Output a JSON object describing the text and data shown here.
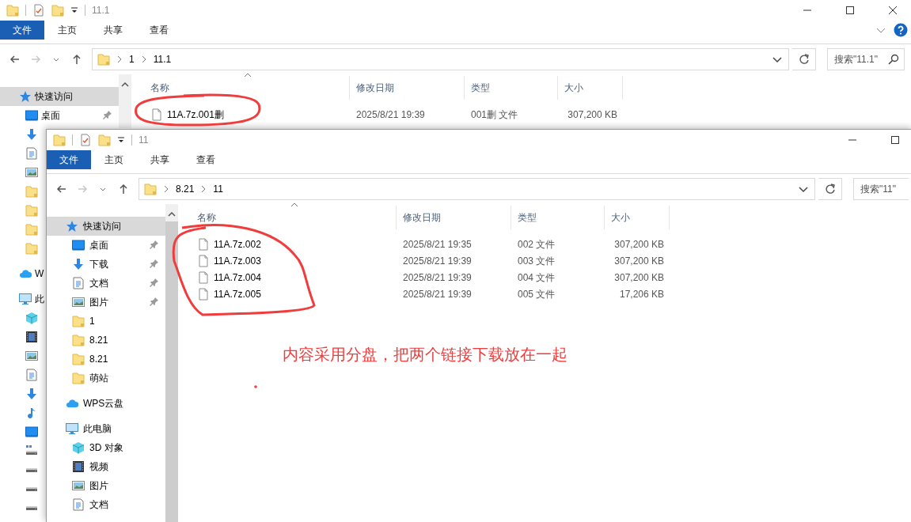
{
  "windows": [
    {
      "title": "11.1",
      "close_button": true,
      "ribbon_extras": true,
      "ribbon_tabs": [
        {
          "label": "文件",
          "selected": true
        },
        {
          "label": "主页",
          "selected": false
        },
        {
          "label": "共享",
          "selected": false
        },
        {
          "label": "查看",
          "selected": false
        }
      ],
      "breadcrumb": [
        "1",
        "11.1"
      ],
      "search": {
        "placeholder": "搜索\"11.1\"",
        "show_icon": true
      },
      "sidebar": [
        {
          "label": "快速访问",
          "kind": "star",
          "selected": true,
          "children": [
            {
              "label": "桌面",
              "kind": "desktop",
              "selected": false,
              "pinned": true
            },
            {
              "kind": "download",
              "selected": false
            },
            {
              "kind": "doc",
              "selected": false
            },
            {
              "kind": "picture",
              "selected": false
            },
            {
              "kind": "folder",
              "selected": false
            },
            {
              "kind": "folder",
              "selected": false
            },
            {
              "kind": "folder",
              "selected": false
            },
            {
              "kind": "folder",
              "selected": false
            }
          ]
        },
        {
          "label": "W",
          "kind": "cloud",
          "selected": false
        },
        {
          "label": "此",
          "kind": "pc",
          "selected": false,
          "children": [
            {
              "kind": "cube",
              "selected": false
            },
            {
              "kind": "video",
              "selected": false
            },
            {
              "kind": "picture",
              "selected": false
            },
            {
              "kind": "doc",
              "selected": false
            },
            {
              "kind": "download",
              "selected": false
            },
            {
              "kind": "music",
              "selected": false
            },
            {
              "kind": "desktop",
              "selected": false
            },
            {
              "kind": "drive-win",
              "selected": false
            },
            {
              "kind": "drive",
              "selected": false
            },
            {
              "kind": "drive",
              "selected": false
            },
            {
              "kind": "drive",
              "selected": false
            }
          ]
        }
      ],
      "columns": [
        "名称",
        "修改日期",
        "类型",
        "大小"
      ],
      "rows": [
        {
          "name": "11A.7z.001删",
          "modified": "2025/8/21 19:39",
          "type": "001删 文件",
          "size": "307,200 KB"
        }
      ]
    },
    {
      "title": "11",
      "close_button": false,
      "ribbon_extras": false,
      "ribbon_tabs": [
        {
          "label": "文件",
          "selected": true
        },
        {
          "label": "主页",
          "selected": false
        },
        {
          "label": "共享",
          "selected": false
        },
        {
          "label": "查看",
          "selected": false
        }
      ],
      "breadcrumb": [
        "8.21",
        "11"
      ],
      "search": {
        "placeholder": "搜索\"11\"",
        "show_icon": false
      },
      "sidebar": [
        {
          "label": "快速访问",
          "kind": "star",
          "selected": true,
          "children": [
            {
              "label": "桌面",
              "kind": "desktop",
              "selected": false,
              "pinned": true
            },
            {
              "label": "下载",
              "kind": "download",
              "selected": false,
              "pinned": true
            },
            {
              "label": "文档",
              "kind": "doc",
              "selected": false,
              "pinned": true
            },
            {
              "label": "图片",
              "kind": "picture",
              "selected": false,
              "pinned": true
            },
            {
              "label": "1",
              "kind": "folder",
              "selected": false,
              "pinned": false
            },
            {
              "label": "8.21",
              "kind": "folder",
              "selected": false,
              "pinned": false
            },
            {
              "label": "8.21",
              "kind": "folder",
              "selected": false,
              "pinned": false
            },
            {
              "label": "萌站",
              "kind": "folder",
              "selected": false,
              "pinned": false
            }
          ]
        },
        {
          "label": "WPS云盘",
          "kind": "cloud",
          "selected": false
        },
        {
          "label": "此电脑",
          "kind": "pc",
          "selected": false,
          "children": [
            {
              "label": "3D 对象",
              "kind": "cube",
              "selected": false
            },
            {
              "label": "视频",
              "kind": "video",
              "selected": false
            },
            {
              "label": "图片",
              "kind": "picture",
              "selected": false
            },
            {
              "label": "文档",
              "kind": "doc",
              "selected": false
            }
          ]
        }
      ],
      "columns": [
        "名称",
        "修改日期",
        "类型",
        "大小"
      ],
      "rows": [
        {
          "name": "11A.7z.002",
          "modified": "2025/8/21 19:35",
          "type": "002 文件",
          "size": "307,200 KB"
        },
        {
          "name": "11A.7z.003",
          "modified": "2025/8/21 19:39",
          "type": "003 文件",
          "size": "307,200 KB"
        },
        {
          "name": "11A.7z.004",
          "modified": "2025/8/21 19:39",
          "type": "004 文件",
          "size": "307,200 KB"
        },
        {
          "name": "11A.7z.005",
          "modified": "2025/8/21 19:39",
          "type": "005 文件",
          "size": "17,206 KB"
        }
      ]
    }
  ],
  "annotation": {
    "text": "内容采用分盘，把两个链接下载放在一起"
  }
}
